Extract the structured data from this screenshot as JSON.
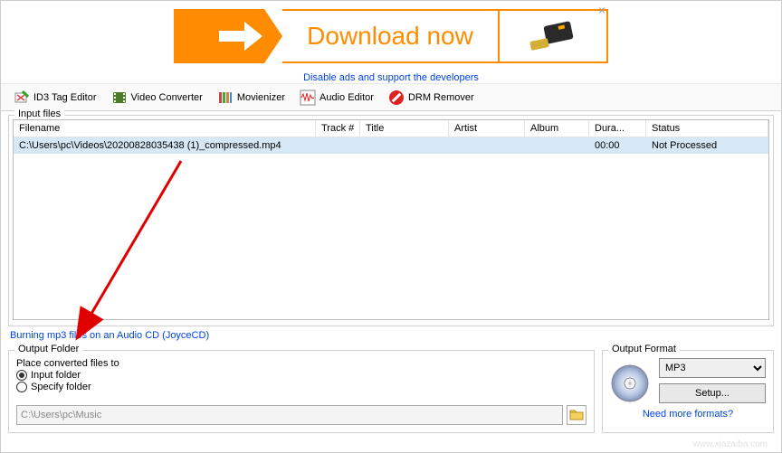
{
  "ad": {
    "label": "Download now",
    "close": "×",
    "disable_text": "Disable ads and support the developers"
  },
  "toolbar": {
    "id3": "ID3 Tag Editor",
    "video": "Video Converter",
    "movienizer": "Movienizer",
    "audio": "Audio Editor",
    "drm": "DRM Remover"
  },
  "input_files": {
    "legend": "Input files",
    "columns": {
      "filename": "Filename",
      "track": "Track #",
      "title": "Title",
      "artist": "Artist",
      "album": "Album",
      "duration": "Dura...",
      "status": "Status"
    },
    "rows": [
      {
        "filename": "C:\\Users\\pc\\Videos\\20200828035438 (1)_compressed.mp4",
        "track": "",
        "title": "",
        "artist": "",
        "album": "",
        "duration": "00:00",
        "status": "Not Processed"
      }
    ],
    "burn_link": "Burning mp3 files on an Audio CD (JoyceCD)"
  },
  "output_folder": {
    "legend": "Output Folder",
    "place_label": "Place converted files to",
    "opt_input": "Input folder",
    "opt_specify": "Specify folder",
    "path": "C:\\Users\\pc\\Music"
  },
  "output_format": {
    "legend": "Output Format",
    "selected": "MP3",
    "setup": "Setup...",
    "need_more": "Need more formats?"
  }
}
